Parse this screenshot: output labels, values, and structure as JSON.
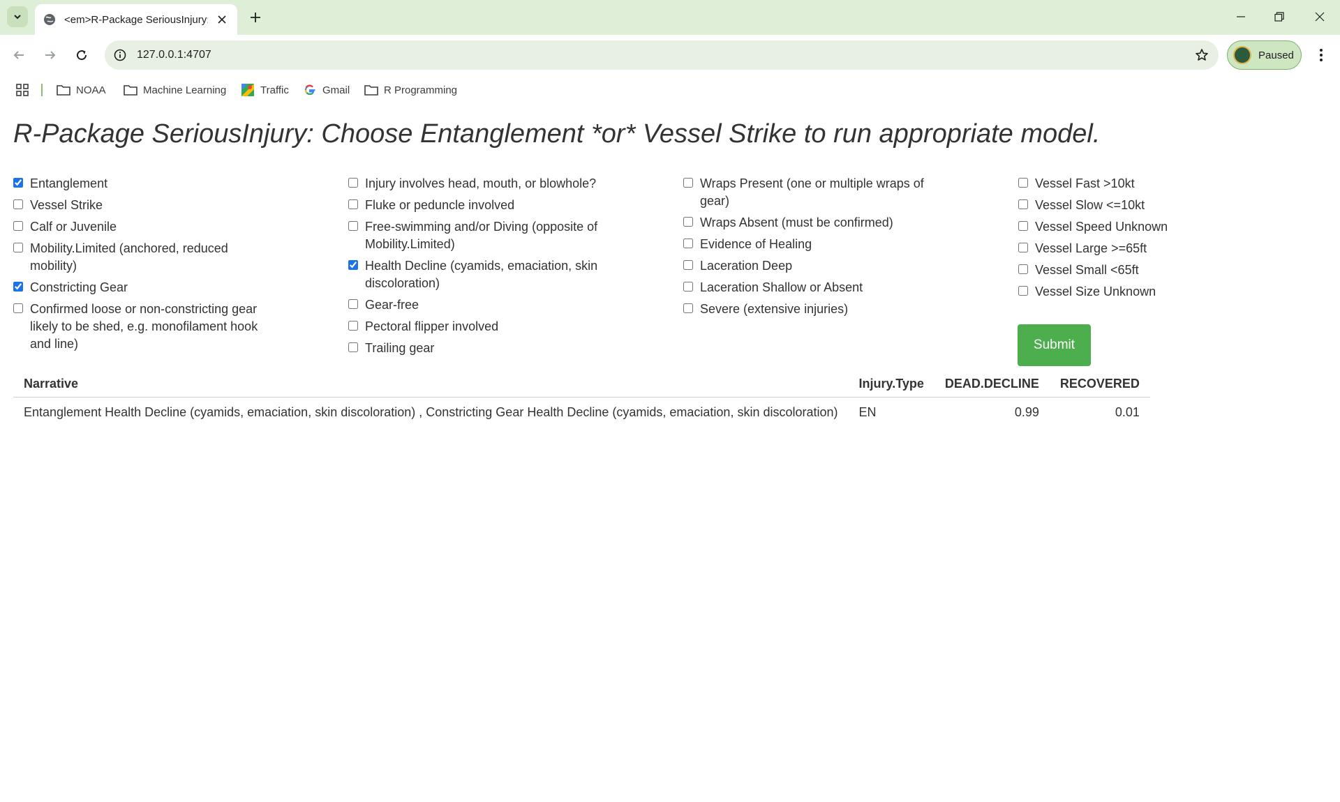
{
  "browser": {
    "tab_title": "<em>R-Package SeriousInjury:",
    "url": "127.0.0.1:4707",
    "profile_label": "Paused",
    "bookmarks": [
      {
        "label": "NOAA",
        "icon": "folder-icon"
      },
      {
        "label": "Machine Learning",
        "icon": "folder-icon"
      },
      {
        "label": "Traffic",
        "icon": "maps-icon"
      },
      {
        "label": "Gmail",
        "icon": "google-icon"
      },
      {
        "label": "R Programming",
        "icon": "folder-icon"
      }
    ]
  },
  "page": {
    "title": "R-Package SeriousInjury: Choose Entanglement *or* Vessel Strike to run appropriate model.",
    "columns": [
      [
        {
          "label": "Entanglement",
          "checked": true
        },
        {
          "label": "Vessel Strike",
          "checked": false
        },
        {
          "label": "Calf or Juvenile",
          "checked": false
        },
        {
          "label": "Mobility.Limited (anchored, reduced mobility)",
          "checked": false
        },
        {
          "label": "Constricting Gear",
          "checked": true
        },
        {
          "label": "Confirmed loose or non-constricting gear likely to be shed, e.g. monofilament hook and line)",
          "checked": false
        }
      ],
      [
        {
          "label": "Injury involves head, mouth, or blowhole?",
          "checked": false
        },
        {
          "label": "Fluke or peduncle involved",
          "checked": false
        },
        {
          "label": "Free-swimming and/or Diving (opposite of Mobility.Limited)",
          "checked": false
        },
        {
          "label": "Health Decline (cyamids, emaciation, skin discoloration)",
          "checked": true
        },
        {
          "label": "Gear-free",
          "checked": false
        },
        {
          "label": "Pectoral flipper involved",
          "checked": false
        },
        {
          "label": "Trailing gear",
          "checked": false
        }
      ],
      [
        {
          "label": "Wraps Present (one or multiple wraps of gear)",
          "checked": false
        },
        {
          "label": "Wraps Absent (must be confirmed)",
          "checked": false
        },
        {
          "label": "Evidence of Healing",
          "checked": false
        },
        {
          "label": "Laceration Deep",
          "checked": false
        },
        {
          "label": "Laceration Shallow or Absent",
          "checked": false
        },
        {
          "label": "Severe (extensive injuries)",
          "checked": false
        }
      ],
      [
        {
          "label": "Vessel Fast >10kt",
          "checked": false
        },
        {
          "label": "Vessel Slow <=10kt",
          "checked": false
        },
        {
          "label": "Vessel Speed Unknown",
          "checked": false
        },
        {
          "label": "Vessel Large >=65ft",
          "checked": false
        },
        {
          "label": "Vessel Small <65ft",
          "checked": false
        },
        {
          "label": "Vessel Size Unknown",
          "checked": false
        }
      ]
    ],
    "submit_label": "Submit",
    "table": {
      "headers": [
        "Narrative",
        "Injury.Type",
        "DEAD.DECLINE",
        "RECOVERED"
      ],
      "rows": [
        [
          "Entanglement Health Decline (cyamids, emaciation, skin discoloration) , Constricting Gear Health Decline (cyamids, emaciation, skin discoloration)",
          "EN",
          "0.99",
          "0.01"
        ]
      ]
    }
  }
}
